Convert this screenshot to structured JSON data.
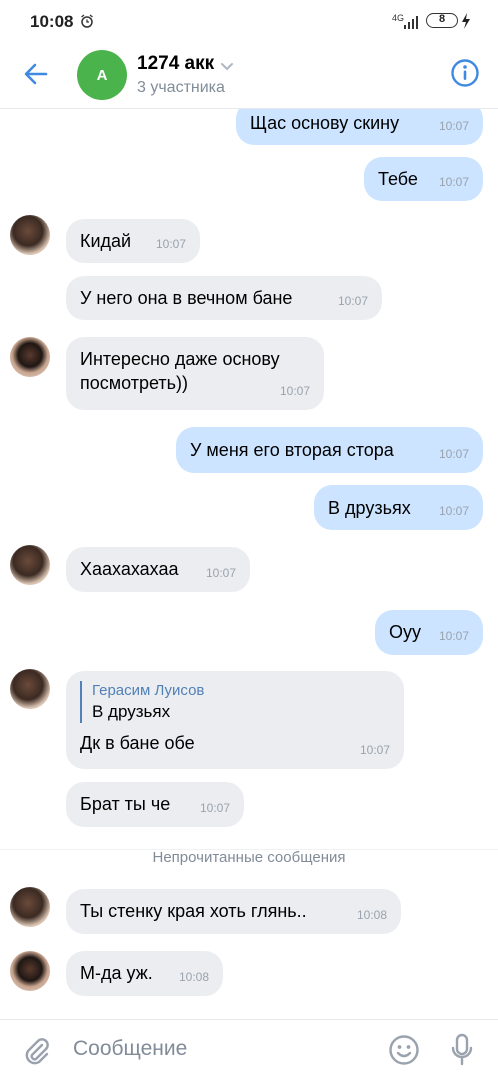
{
  "status_bar": {
    "time": "10:08",
    "network": "4G",
    "battery": "8"
  },
  "header": {
    "avatar_letter": "A",
    "title": "1274 акк",
    "subtitle": "3 участника"
  },
  "messages": [
    {
      "dir": "out",
      "text": "Щас основу скину",
      "time": "10:07"
    },
    {
      "dir": "out",
      "text": "Тебе",
      "time": "10:07"
    },
    {
      "dir": "in",
      "text": "Кидай",
      "time": "10:07"
    },
    {
      "dir": "in",
      "text": "У него она в вечном бане",
      "time": "10:07"
    },
    {
      "dir": "in",
      "text_line1": "Интересно даже основу",
      "text_line2": "посмотреть))",
      "time": "10:07"
    },
    {
      "dir": "out",
      "text": "У меня его вторая стора",
      "time": "10:07"
    },
    {
      "dir": "out",
      "text": "В друзьях",
      "time": "10:07"
    },
    {
      "dir": "in",
      "text": "Хаахахахаа",
      "time": "10:07"
    },
    {
      "dir": "out",
      "text": "Оуу",
      "time": "10:07"
    },
    {
      "dir": "in",
      "reply_name": "Герасим Луисов",
      "reply_text": "В друзьях",
      "text": "Дк в бане обе",
      "time": "10:07"
    },
    {
      "dir": "in",
      "text": "Брат ты че",
      "time": "10:07"
    },
    {
      "dir": "in",
      "text": "Ты стенку края хоть глянь..",
      "time": "10:08"
    },
    {
      "dir": "in",
      "text": "М-да уж.",
      "time": "10:08"
    }
  ],
  "unread_divider": "Непрочитанные сообщения",
  "composer": {
    "placeholder": "Сообщение"
  },
  "colors": {
    "accent": "#5181b8",
    "outgoing_bubble": "#cce4ff",
    "incoming_bubble": "#ebedf0",
    "avatar_green": "#4bb34b"
  }
}
